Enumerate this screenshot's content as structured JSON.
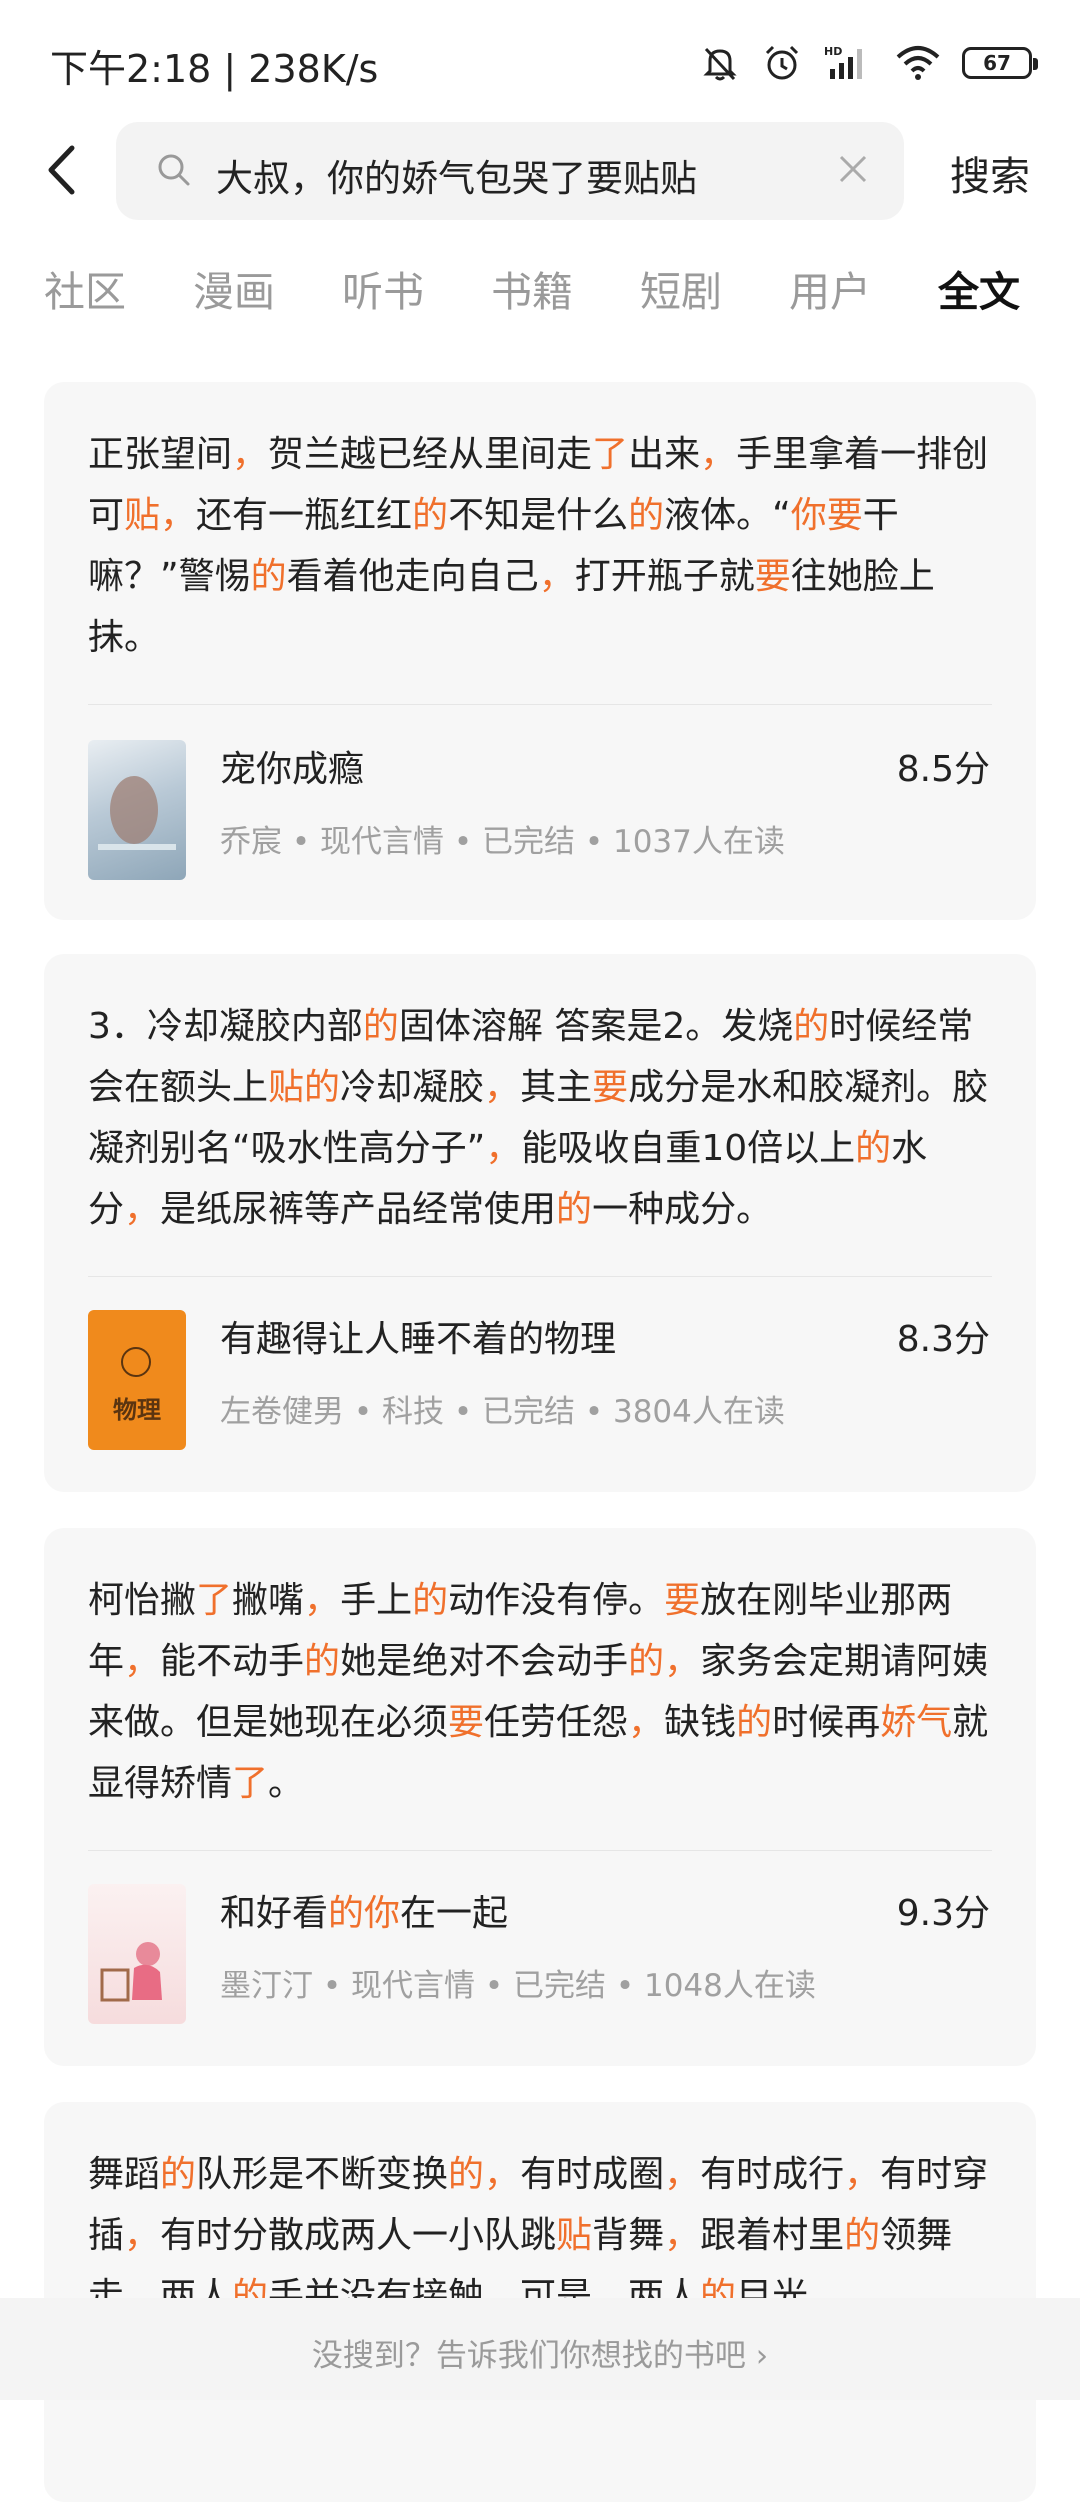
{
  "status_bar": {
    "time": "下午2:18 | 238K/s",
    "battery": "67",
    "icons": [
      "mute-bell-icon",
      "alarm-icon",
      "signal-icon",
      "wifi-icon",
      "battery-icon"
    ]
  },
  "search": {
    "query": "大叔，你的娇气包哭了要贴贴",
    "button_label": "搜索"
  },
  "tabs": [
    {
      "label": "社区",
      "active": false
    },
    {
      "label": "漫画",
      "active": false
    },
    {
      "label": "听书",
      "active": false
    },
    {
      "label": "书籍",
      "active": false
    },
    {
      "label": "短剧",
      "active": false
    },
    {
      "label": "用户",
      "active": false
    },
    {
      "label": "全文",
      "active": true
    }
  ],
  "colors": {
    "highlight": "#f0702c",
    "card_bg": "#f7f7f7"
  },
  "results": [
    {
      "excerpt_segments": [
        {
          "t": "正张望间"
        },
        {
          "t": "，",
          "hl": true
        },
        {
          "t": "贺兰越已经从里间走"
        },
        {
          "t": "了",
          "hl": true
        },
        {
          "t": "出来"
        },
        {
          "t": "，",
          "hl": true
        },
        {
          "t": "手里拿着一排创可"
        },
        {
          "t": "贴",
          "hl": true
        },
        {
          "t": "，",
          "hl": true
        },
        {
          "t": "还有一瓶红红"
        },
        {
          "t": "的",
          "hl": true
        },
        {
          "t": "不知是什么"
        },
        {
          "t": "的",
          "hl": true
        },
        {
          "t": "液体。“"
        },
        {
          "t": "你要",
          "hl": true
        },
        {
          "t": "干嘛？”警惕"
        },
        {
          "t": "的",
          "hl": true
        },
        {
          "t": "看着他走向自己"
        },
        {
          "t": "，",
          "hl": true
        },
        {
          "t": "打开瓶子就"
        },
        {
          "t": "要",
          "hl": true
        },
        {
          "t": "往她脸上抹。"
        }
      ],
      "book": {
        "title_segments": [
          {
            "t": "宠你成瘾"
          }
        ],
        "meta": "乔宸 • 现代言情 • 已完结 • 1037人在读",
        "score": "8.5分"
      }
    },
    {
      "excerpt_segments": [
        {
          "t": "3．冷却凝胶内部"
        },
        {
          "t": "的",
          "hl": true
        },
        {
          "t": "固体溶解 答案是2。发烧"
        },
        {
          "t": "的",
          "hl": true
        },
        {
          "t": "时候经常会在额头上"
        },
        {
          "t": "贴的",
          "hl": true
        },
        {
          "t": "冷却凝胶"
        },
        {
          "t": "，",
          "hl": true
        },
        {
          "t": "其主"
        },
        {
          "t": "要",
          "hl": true
        },
        {
          "t": "成分是水和胶凝剂。胶凝剂别名“吸水性高分子”"
        },
        {
          "t": "，",
          "hl": true
        },
        {
          "t": "能吸收自重10倍以上"
        },
        {
          "t": "的",
          "hl": true
        },
        {
          "t": "水分"
        },
        {
          "t": "，",
          "hl": true
        },
        {
          "t": "是纸尿裤等产品经常使用"
        },
        {
          "t": "的",
          "hl": true
        },
        {
          "t": "一种成分。"
        }
      ],
      "book": {
        "title_segments": [
          {
            "t": "有趣得让人睡不着的物理"
          }
        ],
        "meta": "左卷健男 • 科技 • 已完结 • 3804人在读",
        "score": "8.3分",
        "cover_text": "物理"
      }
    },
    {
      "excerpt_segments": [
        {
          "t": "柯怡撇"
        },
        {
          "t": "了",
          "hl": true
        },
        {
          "t": "撇嘴"
        },
        {
          "t": "，",
          "hl": true
        },
        {
          "t": "手上"
        },
        {
          "t": "的",
          "hl": true
        },
        {
          "t": "动作没有停。"
        },
        {
          "t": "要",
          "hl": true
        },
        {
          "t": "放在刚毕业那两年"
        },
        {
          "t": "，",
          "hl": true
        },
        {
          "t": "能不动手"
        },
        {
          "t": "的",
          "hl": true
        },
        {
          "t": "她是绝对不会动手"
        },
        {
          "t": "的，",
          "hl": true
        },
        {
          "t": "家务会定期请阿姨来做。但是她现在必须"
        },
        {
          "t": "要",
          "hl": true
        },
        {
          "t": "任劳任怨"
        },
        {
          "t": "，",
          "hl": true
        },
        {
          "t": "缺钱"
        },
        {
          "t": "的",
          "hl": true
        },
        {
          "t": "时候再"
        },
        {
          "t": "娇气",
          "hl": true
        },
        {
          "t": "就显得矫情"
        },
        {
          "t": "了",
          "hl": true
        },
        {
          "t": "。"
        }
      ],
      "book": {
        "title_segments": [
          {
            "t": "和好看"
          },
          {
            "t": "的你",
            "hl": true
          },
          {
            "t": "在一起"
          }
        ],
        "meta": "墨汀汀 • 现代言情 • 已完结 • 1048人在读",
        "score": "9.3分"
      }
    },
    {
      "excerpt_segments": [
        {
          "t": "舞蹈"
        },
        {
          "t": "的",
          "hl": true
        },
        {
          "t": "队形是不断变换"
        },
        {
          "t": "的，",
          "hl": true
        },
        {
          "t": "有时成圈"
        },
        {
          "t": "，",
          "hl": true
        },
        {
          "t": "有时成行"
        },
        {
          "t": "，",
          "hl": true
        },
        {
          "t": "有时穿插"
        },
        {
          "t": "，",
          "hl": true
        },
        {
          "t": "有时分散成两人一小队跳"
        },
        {
          "t": "贴",
          "hl": true
        },
        {
          "t": "背舞"
        },
        {
          "t": "，",
          "hl": true
        },
        {
          "t": "跟着村里"
        },
        {
          "t": "的",
          "hl": true
        },
        {
          "t": "领舞走，两人"
        },
        {
          "t": "的",
          "hl": true
        },
        {
          "t": "手并没有接触，可是，两人"
        },
        {
          "t": "的",
          "hl": true
        },
        {
          "t": "目光"
        }
      ]
    }
  ],
  "footer": {
    "prompt": "没搜到？告诉我们你想找的书吧  ›"
  }
}
